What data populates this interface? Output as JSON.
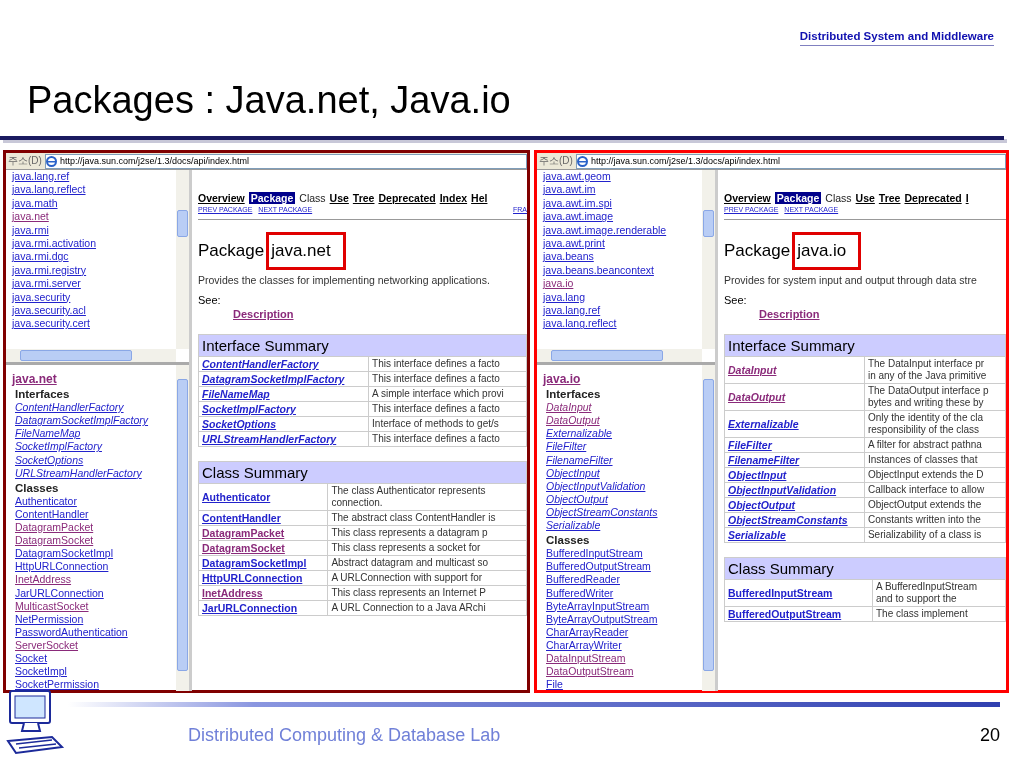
{
  "header": {
    "tag": "Distributed System and Middleware",
    "title": "Packages : Java.net,  Java.io"
  },
  "screens": [
    {
      "color": "#800000",
      "address_label": "주소(D)",
      "url": "http://java.sun.com/j2se/1.3/docs/api/index.html",
      "packages": [
        {
          "text": "java.lang.ref",
          "visited": false
        },
        {
          "text": "java.lang.reflect",
          "visited": false
        },
        {
          "text": "java.math",
          "visited": false
        },
        {
          "text": "java.net",
          "visited": true
        },
        {
          "text": "java.rmi",
          "visited": false
        },
        {
          "text": "java.rmi.activation",
          "visited": false
        },
        {
          "text": "java.rmi.dgc",
          "visited": false
        },
        {
          "text": "java.rmi.registry",
          "visited": false
        },
        {
          "text": "java.rmi.server",
          "visited": false
        },
        {
          "text": "java.security",
          "visited": false
        },
        {
          "text": "java.security.acl",
          "visited": false
        },
        {
          "text": "java.security.cert",
          "visited": false
        }
      ],
      "class_frame": {
        "package": {
          "text": "java.net",
          "visited": true
        },
        "interfaces_label": "Interfaces",
        "interfaces": [
          {
            "text": "ContentHandlerFactory",
            "visited": false
          },
          {
            "text": "DatagramSocketImplFactory",
            "visited": false
          },
          {
            "text": "FileNameMap",
            "visited": false
          },
          {
            "text": "SocketImplFactory",
            "visited": false
          },
          {
            "text": "SocketOptions",
            "visited": false
          },
          {
            "text": "URLStreamHandlerFactory",
            "visited": false
          }
        ],
        "classes_label": "Classes",
        "classes": [
          {
            "text": "Authenticator",
            "visited": false
          },
          {
            "text": "ContentHandler",
            "visited": false
          },
          {
            "text": "DatagramPacket",
            "visited": true
          },
          {
            "text": "DatagramSocket",
            "visited": true
          },
          {
            "text": "DatagramSocketImpl",
            "visited": false
          },
          {
            "text": "HttpURLConnection",
            "visited": false
          },
          {
            "text": "InetAddress",
            "visited": true
          },
          {
            "text": "JarURLConnection",
            "visited": false
          },
          {
            "text": "MulticastSocket",
            "visited": true
          },
          {
            "text": "NetPermission",
            "visited": false
          },
          {
            "text": "PasswordAuthentication",
            "visited": false
          },
          {
            "text": "ServerSocket",
            "visited": true
          },
          {
            "text": "Socket",
            "visited": false
          },
          {
            "text": "SocketImpl",
            "visited": false
          },
          {
            "text": "SocketPermission",
            "visited": false
          }
        ]
      },
      "nav": [
        {
          "text": "Overview",
          "link": true,
          "selected": false
        },
        {
          "text": "Package",
          "link": false,
          "selected": true
        },
        {
          "text": "Class",
          "link": false,
          "selected": false
        },
        {
          "text": "Use",
          "link": true,
          "selected": false
        },
        {
          "text": "Tree",
          "link": true,
          "selected": false
        },
        {
          "text": "Deprecated",
          "link": true,
          "selected": false
        },
        {
          "text": "Index",
          "link": true,
          "selected": false
        },
        {
          "text": "Hel",
          "link": true,
          "selected": false
        }
      ],
      "subnav": [
        "PREV PACKAGE",
        "NEXT PACKAGE"
      ],
      "subnav_right": "FRA",
      "heading": "Package",
      "package_name": "java.net",
      "description": "Provides the classes for implementing networking applications.",
      "see_label": "See:",
      "see_link": {
        "text": "Description",
        "visited": true
      },
      "interface_summary": {
        "title": "Interface Summary",
        "rows": [
          {
            "name": "ContentHandlerFactory",
            "visited": false,
            "desc": "This interface defines a facto"
          },
          {
            "name": "DatagramSocketImplFactory",
            "visited": false,
            "desc": "This interface defines a facto"
          },
          {
            "name": "FileNameMap",
            "visited": false,
            "desc": "A simple interface which provi"
          },
          {
            "name": "SocketImplFactory",
            "visited": false,
            "desc": "This interface defines a facto"
          },
          {
            "name": "SocketOptions",
            "visited": false,
            "desc": "Interface of methods to get/s"
          },
          {
            "name": "URLStreamHandlerFactory",
            "visited": false,
            "desc": "This interface defines a facto"
          }
        ]
      },
      "class_summary": {
        "title": "Class Summary",
        "rows": [
          {
            "name": "Authenticator",
            "visited": false,
            "desc": "The class Authenticator represents\nconnection."
          },
          {
            "name": "ContentHandler",
            "visited": false,
            "desc": "The abstract class ContentHandler is"
          },
          {
            "name": "DatagramPacket",
            "visited": true,
            "desc": "This class represents a datagram p"
          },
          {
            "name": "DatagramSocket",
            "visited": true,
            "desc": "This class represents a socket for"
          },
          {
            "name": "DatagramSocketImpl",
            "visited": false,
            "desc": "Abstract datagram and multicast so"
          },
          {
            "name": "HttpURLConnection",
            "visited": false,
            "desc": "A URLConnection with support for"
          },
          {
            "name": "InetAddress",
            "visited": true,
            "desc": "This class represents an Internet P"
          },
          {
            "name": "JarURLConnection",
            "visited": false,
            "desc": "A URL Connection to a Java ARchi"
          }
        ]
      }
    },
    {
      "color": "#ff0000",
      "address_label": "주소(D)",
      "url": "http://java.sun.com/j2se/1.3/docs/api/index.html",
      "packages": [
        {
          "text": "java.awt.geom",
          "visited": false
        },
        {
          "text": "java.awt.im",
          "visited": false
        },
        {
          "text": "java.awt.im.spi",
          "visited": false
        },
        {
          "text": "java.awt.image",
          "visited": false
        },
        {
          "text": "java.awt.image.renderable",
          "visited": false
        },
        {
          "text": "java.awt.print",
          "visited": false
        },
        {
          "text": "java.beans",
          "visited": false
        },
        {
          "text": "java.beans.beancontext",
          "visited": false
        },
        {
          "text": "java.io",
          "visited": true
        },
        {
          "text": "java.lang",
          "visited": false
        },
        {
          "text": "java.lang.ref",
          "visited": false
        },
        {
          "text": "java.lang.reflect",
          "visited": false
        }
      ],
      "class_frame": {
        "package": {
          "text": "java.io",
          "visited": true
        },
        "interfaces_label": "Interfaces",
        "interfaces": [
          {
            "text": "DataInput",
            "visited": true
          },
          {
            "text": "DataOutput",
            "visited": true
          },
          {
            "text": "Externalizable",
            "visited": false
          },
          {
            "text": "FileFilter",
            "visited": false
          },
          {
            "text": "FilenameFilter",
            "visited": false
          },
          {
            "text": "ObjectInput",
            "visited": false
          },
          {
            "text": "ObjectInputValidation",
            "visited": false
          },
          {
            "text": "ObjectOutput",
            "visited": false
          },
          {
            "text": "ObjectStreamConstants",
            "visited": false
          },
          {
            "text": "Serializable",
            "visited": false
          }
        ],
        "classes_label": "Classes",
        "classes": [
          {
            "text": "BufferedInputStream",
            "visited": false
          },
          {
            "text": "BufferedOutputStream",
            "visited": false
          },
          {
            "text": "BufferedReader",
            "visited": false
          },
          {
            "text": "BufferedWriter",
            "visited": false
          },
          {
            "text": "ByteArrayInputStream",
            "visited": false
          },
          {
            "text": "ByteArrayOutputStream",
            "visited": false
          },
          {
            "text": "CharArrayReader",
            "visited": false
          },
          {
            "text": "CharArrayWriter",
            "visited": false
          },
          {
            "text": "DataInputStream",
            "visited": true
          },
          {
            "text": "DataOutputStream",
            "visited": true
          },
          {
            "text": "File",
            "visited": false
          }
        ]
      },
      "nav": [
        {
          "text": "Overview",
          "link": true,
          "selected": false
        },
        {
          "text": "Package",
          "link": false,
          "selected": true
        },
        {
          "text": "Class",
          "link": false,
          "selected": false
        },
        {
          "text": "Use",
          "link": true,
          "selected": false
        },
        {
          "text": "Tree",
          "link": true,
          "selected": false
        },
        {
          "text": "Deprecated",
          "link": true,
          "selected": false
        },
        {
          "text": "I",
          "link": true,
          "selected": false
        }
      ],
      "subnav": [
        "PREV PACKAGE",
        "NEXT PACKAGE"
      ],
      "heading": "Package",
      "package_name": "java.io",
      "description": "Provides for system input and output through data stre",
      "see_label": "See:",
      "see_link": {
        "text": "Description",
        "visited": true
      },
      "interface_summary": {
        "title": "Interface Summary",
        "rows": [
          {
            "name": "DataInput",
            "visited": true,
            "desc": "The DataInput interface pr\nin any of the Java primitive"
          },
          {
            "name": "DataOutput",
            "visited": true,
            "desc": "The DataOutput interface p\nbytes and writing these by"
          },
          {
            "name": "Externalizable",
            "visited": false,
            "desc": "Only the identity of the cla\nresponsibility of the class"
          },
          {
            "name": "FileFilter",
            "visited": false,
            "desc": "A filter for abstract pathna"
          },
          {
            "name": "FilenameFilter",
            "visited": false,
            "desc": "Instances of classes that"
          },
          {
            "name": "ObjectInput",
            "visited": false,
            "desc": "ObjectInput extends the D"
          },
          {
            "name": "ObjectInputValidation",
            "visited": false,
            "desc": "Callback interface to allow"
          },
          {
            "name": "ObjectOutput",
            "visited": false,
            "desc": "ObjectOutput extends the"
          },
          {
            "name": "ObjectStreamConstants",
            "visited": false,
            "desc": "Constants written into the"
          },
          {
            "name": "Serializable",
            "visited": false,
            "desc": "Serializability of a class is"
          }
        ]
      },
      "class_summary": {
        "title": "Class Summary",
        "rows": [
          {
            "name": "BufferedInputStream",
            "visited": false,
            "desc": "A BufferedInputStream\nand to support the"
          },
          {
            "name": "BufferedOutputStream",
            "visited": false,
            "desc": "The class implement"
          }
        ]
      }
    }
  ],
  "footer": {
    "lab": "Distributed Computing & Database Lab",
    "page": "20"
  }
}
